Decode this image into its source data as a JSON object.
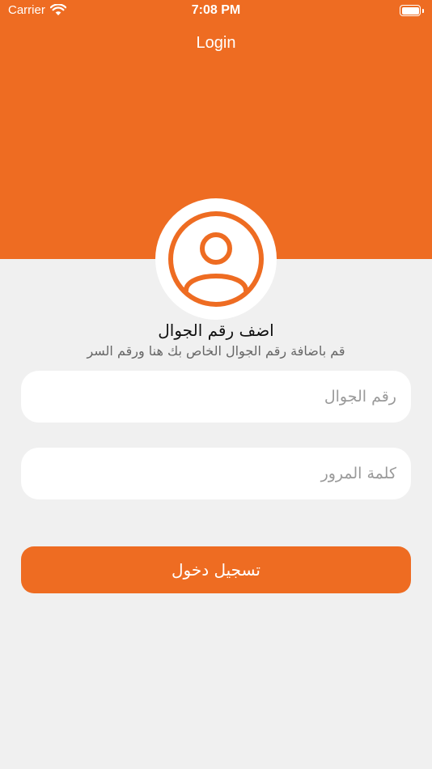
{
  "status_bar": {
    "carrier": "Carrier",
    "time": "7:08 PM"
  },
  "nav": {
    "title": "Login"
  },
  "avatar": {
    "icon": "user-avatar-icon"
  },
  "intro": {
    "title": "اضف رقم الجوال",
    "subtitle": "قم باضافة رقم الجوال الخاص بك هنا ورقم السر"
  },
  "form": {
    "phone_placeholder": "رقم الجوال",
    "phone_value": "",
    "password_placeholder": "كلمة المرور",
    "password_value": "",
    "login_label": "تسجيل دخول"
  },
  "colors": {
    "accent": "#EE6C22",
    "background": "#F0F0F0",
    "field_background": "#FFFFFF"
  }
}
